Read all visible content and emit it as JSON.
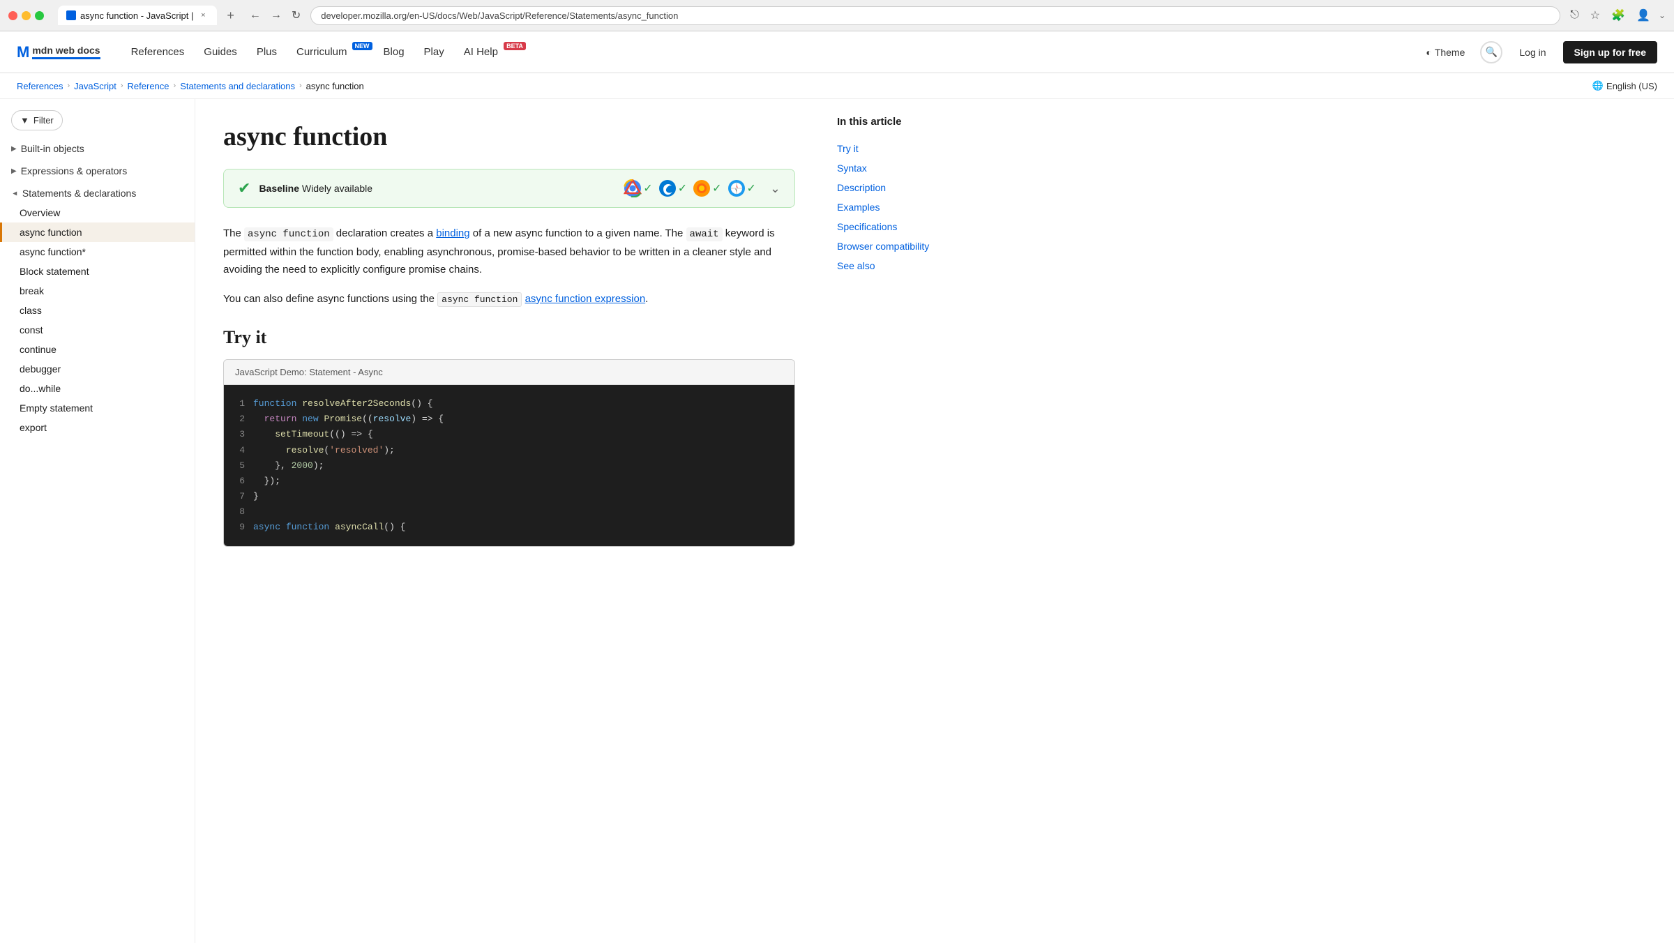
{
  "browser": {
    "traffic_lights": [
      "red",
      "yellow",
      "green"
    ],
    "tab_title": "async function - JavaScript |",
    "tab_close": "×",
    "tab_new": "+",
    "nav_back": "←",
    "nav_forward": "→",
    "nav_refresh": "↻",
    "address": "developer.mozilla.org/en-US/docs/Web/JavaScript/Reference/Statements/async_function",
    "share_icon": "⎋",
    "bookmark_icon": "☆",
    "extensions_icon": "🧩",
    "account_icon": "👤",
    "more_icon": "⌄"
  },
  "header": {
    "logo_m": "M",
    "logo_text": "mdn web docs",
    "nav_items": [
      {
        "label": "References",
        "badge": null
      },
      {
        "label": "Guides",
        "badge": null
      },
      {
        "label": "Plus",
        "badge": null
      },
      {
        "label": "Curriculum",
        "badge": {
          "text": "NEW",
          "type": "new"
        }
      },
      {
        "label": "Blog",
        "badge": null
      },
      {
        "label": "Play",
        "badge": null
      },
      {
        "label": "AI Help",
        "badge": {
          "text": "BETA",
          "type": "beta"
        }
      }
    ],
    "theme_icon": "◐",
    "theme_label": "Theme",
    "search_icon": "🔍",
    "login_label": "Log in",
    "signup_label": "Sign up for free"
  },
  "breadcrumb": {
    "items": [
      {
        "label": "References",
        "href": "#"
      },
      {
        "label": "JavaScript",
        "href": "#"
      },
      {
        "label": "Reference",
        "href": "#"
      },
      {
        "label": "Statements and declarations",
        "href": "#"
      },
      {
        "label": "async function",
        "href": null
      }
    ],
    "lang": "English (US)"
  },
  "sidebar": {
    "filter_label": "Filter",
    "sections": [
      {
        "label": "Built-in objects",
        "open": false,
        "items": []
      },
      {
        "label": "Expressions & operators",
        "open": false,
        "items": []
      },
      {
        "label": "Statements & declarations",
        "open": true,
        "items": [
          {
            "label": "Overview",
            "active": false
          },
          {
            "label": "async function",
            "active": true
          },
          {
            "label": "async function*",
            "active": false
          },
          {
            "label": "Block statement",
            "active": false
          },
          {
            "label": "break",
            "active": false
          },
          {
            "label": "class",
            "active": false
          },
          {
            "label": "const",
            "active": false
          },
          {
            "label": "continue",
            "active": false
          },
          {
            "label": "debugger",
            "active": false
          },
          {
            "label": "do...while",
            "active": false
          },
          {
            "label": "Empty statement",
            "active": false
          },
          {
            "label": "export",
            "active": false
          }
        ]
      }
    ]
  },
  "content": {
    "page_title": "async function",
    "baseline": {
      "icon": "✔",
      "strong": "Baseline",
      "text": "Widely available",
      "expand_icon": "⌄"
    },
    "description1": "The async function declaration creates a binding of a new async function to a given name. The await keyword is permitted within the function body, enabling asynchronous, promise-based behavior to be written in a cleaner style and avoiding the need to explicitly configure promise chains.",
    "binding_text": "binding",
    "description2": "You can also define async functions using the",
    "async_link_text": "async function expression",
    "description2_end": ".",
    "try_it_title": "Try it",
    "code_demo": {
      "header": "JavaScript Demo: Statement - Async",
      "lines": [
        {
          "num": "1",
          "content": "function resolveAfter2Seconds() {"
        },
        {
          "num": "2",
          "content": "  return new Promise((resolve) => {"
        },
        {
          "num": "3",
          "content": "    setTimeout(() => {"
        },
        {
          "num": "4",
          "content": "      resolve('resolved');"
        },
        {
          "num": "5",
          "content": "    }, 2000);"
        },
        {
          "num": "6",
          "content": "  });"
        },
        {
          "num": "7",
          "content": "}"
        },
        {
          "num": "8",
          "content": ""
        },
        {
          "num": "9",
          "content": "async function asyncCall() {"
        }
      ]
    }
  },
  "toc": {
    "title": "In this article",
    "items": [
      {
        "label": "Try it"
      },
      {
        "label": "Syntax"
      },
      {
        "label": "Description"
      },
      {
        "label": "Examples"
      },
      {
        "label": "Specifications"
      },
      {
        "label": "Browser compatibility"
      },
      {
        "label": "See also"
      }
    ]
  }
}
